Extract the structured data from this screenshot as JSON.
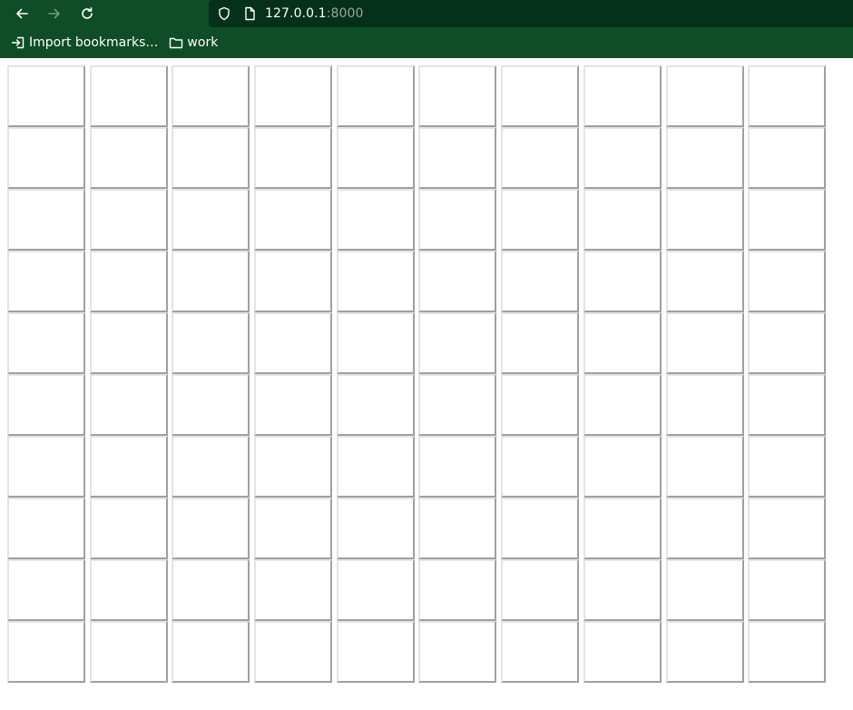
{
  "browser": {
    "url_host": "127.0.0.1",
    "url_port": ":8000",
    "bookmarks": [
      {
        "label": "Import bookmarks…",
        "icon": "import-icon"
      },
      {
        "label": "work",
        "icon": "folder-icon"
      }
    ]
  },
  "grid": {
    "rows": 10,
    "cols": 10
  },
  "colors": {
    "chrome_bg": "#0e4d25",
    "url_bar_bg": "#05311a"
  }
}
